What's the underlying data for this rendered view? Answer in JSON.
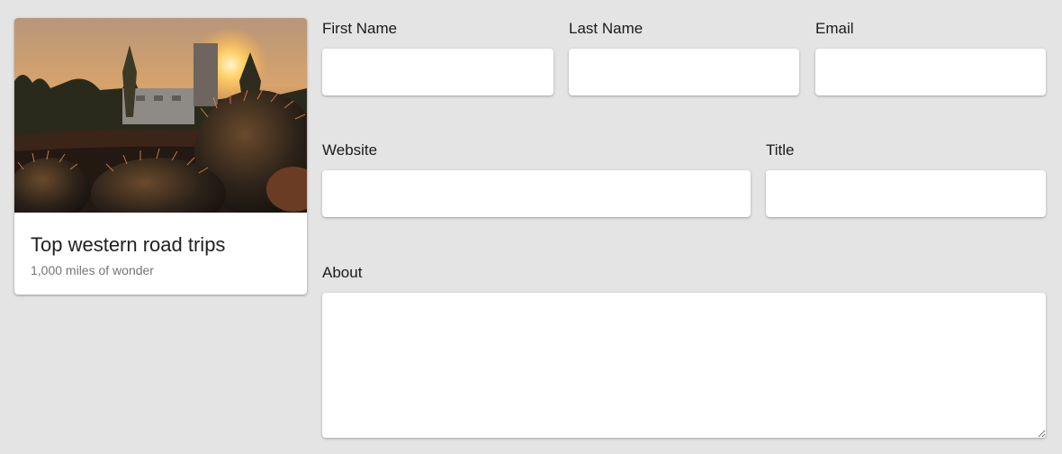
{
  "card": {
    "image_alt": "Cactus silhouetted against a sunset with buildings in the background",
    "title": "Top western road trips",
    "subtitle": "1,000 miles of wonder"
  },
  "form": {
    "first_name": {
      "label": "First Name",
      "value": "",
      "placeholder": ""
    },
    "last_name": {
      "label": "Last Name",
      "value": "",
      "placeholder": ""
    },
    "email": {
      "label": "Email",
      "value": "",
      "placeholder": ""
    },
    "website": {
      "label": "Website",
      "value": "",
      "placeholder": ""
    },
    "title": {
      "label": "Title",
      "value": "",
      "placeholder": ""
    },
    "about": {
      "label": "About",
      "value": "",
      "placeholder": ""
    }
  },
  "colors": {
    "page_background": "#e4e4e4",
    "surface": "#ffffff",
    "text_primary": "#212121",
    "text_secondary": "#757575"
  }
}
